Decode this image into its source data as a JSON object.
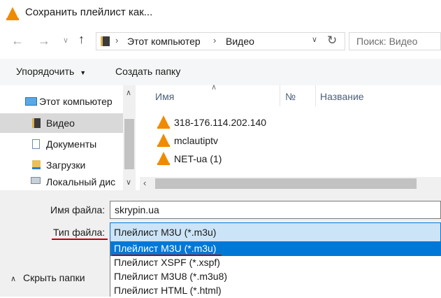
{
  "window": {
    "title": "Сохранить плейлист как..."
  },
  "nav": {
    "breadcrumb": [
      "Этот компьютер",
      "Видео"
    ],
    "search_placeholder": "Поиск: Видео"
  },
  "toolbar": {
    "organize_label": "Упорядочить",
    "new_folder_label": "Создать папку"
  },
  "tree": {
    "items": [
      {
        "label": "Этот компьютер"
      },
      {
        "label": "Видео"
      },
      {
        "label": "Документы"
      },
      {
        "label": "Загрузки"
      },
      {
        "label": "Локальный дис"
      }
    ]
  },
  "columns": {
    "name": "Имя",
    "number": "№",
    "title": "Название"
  },
  "files": [
    {
      "name": "318-176.114.202.140"
    },
    {
      "name": "mclautiptv"
    },
    {
      "name": "NET-ua (1)"
    }
  ],
  "form": {
    "filename_label": "Имя файла:",
    "filename_value": "skrypin.ua",
    "filetype_label": "Тип файла:",
    "filetype_value": "Плейлист M3U (*.m3u)",
    "filetype_options": [
      "Плейлист M3U (*.m3u)",
      "Плейлист XSPF (*.xspf)",
      "Плейлист M3U8 (*.m3u8)",
      "Плейлист HTML (*.html)"
    ],
    "hide_folders_label": "Скрыть папки"
  },
  "colors": {
    "accent": "#0078d7",
    "highlight_line": "#c00000",
    "vlc_orange": "#f08a00"
  }
}
